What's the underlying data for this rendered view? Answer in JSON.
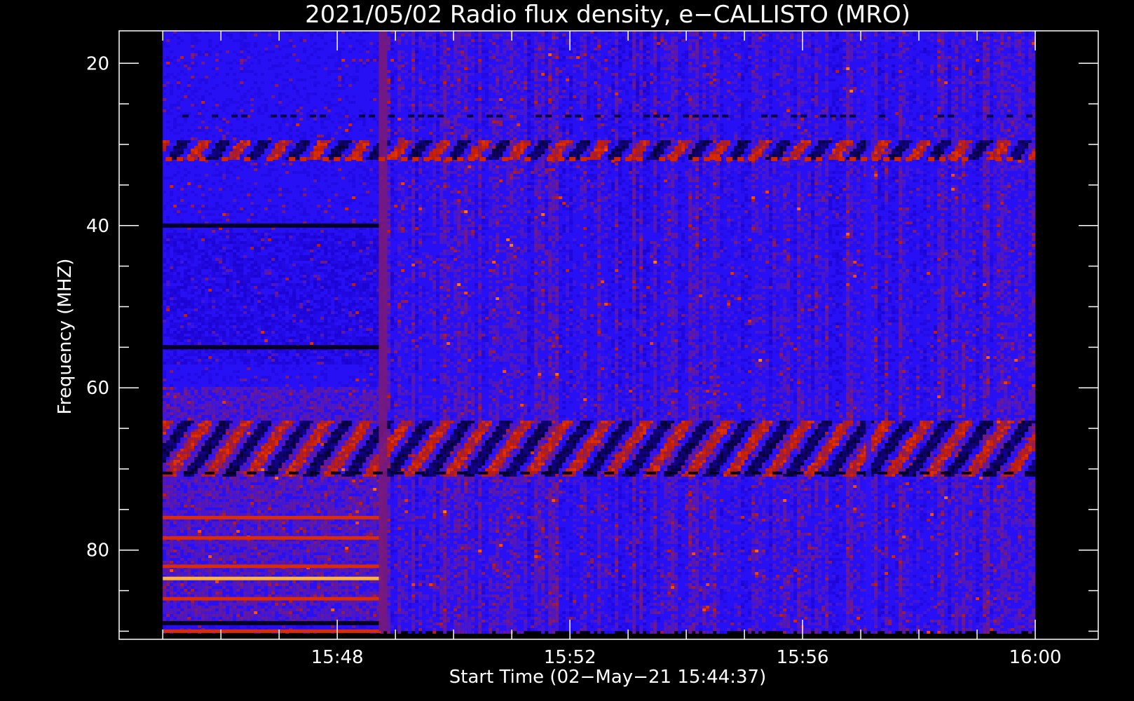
{
  "chart_data": {
    "type": "heatmap",
    "title": "2021/05/02  Radio flux density, e−CALLISTO (MRO)",
    "xlabel": "Start Time (02−May−21 15:44:37)",
    "ylabel": "Frequency (MHZ)",
    "x_start": "15:44:37",
    "xlim": [
      "15:44:15",
      "16:01:05"
    ],
    "data_x_range": [
      "15:45:00",
      "16:00:00"
    ],
    "x_ticks": [
      "15:48",
      "15:52",
      "15:56",
      "16:00"
    ],
    "ylim": [
      16,
      91
    ],
    "data_y_range": [
      16,
      90
    ],
    "y_inverted": true,
    "y_ticks": [
      20,
      40,
      60,
      80
    ],
    "colormap": [
      "#000000",
      "#1a00c8",
      "#2a14ff",
      "#7a1a78",
      "#c81e00",
      "#ff4a00",
      "#ffc040"
    ],
    "features": {
      "onset_time": "15:48:45",
      "strong_channels_before_onset_mhz": [
        76,
        78.5,
        82,
        83.5,
        86,
        90
      ],
      "dark_channels_before_onset_mhz": [
        40,
        55,
        89
      ],
      "modulated_band_1_mhz": [
        29.5,
        32
      ],
      "modulated_band_2_mhz": [
        64,
        71
      ],
      "dashed_channel_mhz": 70.5,
      "line_channel_mhz": 26.5,
      "gap_times": [
        "15:57:05"
      ]
    }
  }
}
